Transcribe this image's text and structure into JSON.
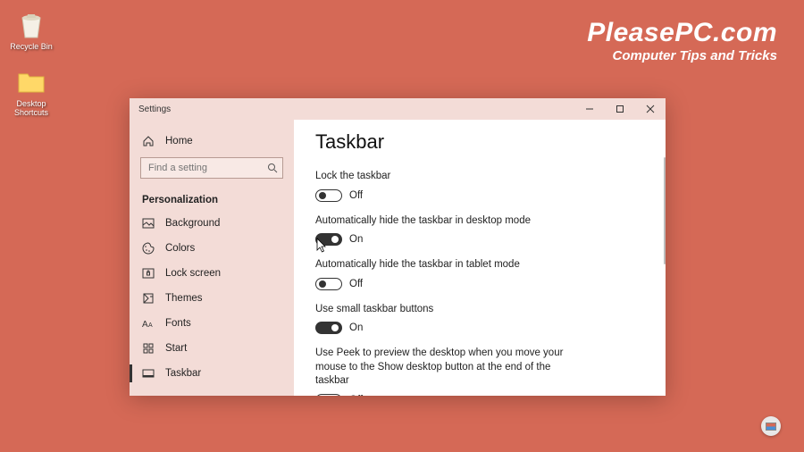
{
  "desktop": {
    "icons": [
      {
        "label": "Recycle Bin"
      },
      {
        "label": "Desktop Shortcuts"
      }
    ]
  },
  "brand": {
    "title": "PleasePC.com",
    "subtitle": "Computer Tips and Tricks"
  },
  "window": {
    "title": "Settings",
    "home_label": "Home",
    "search_placeholder": "Find a setting",
    "section_label": "Personalization",
    "nav": [
      {
        "label": "Background"
      },
      {
        "label": "Colors"
      },
      {
        "label": "Lock screen"
      },
      {
        "label": "Themes"
      },
      {
        "label": "Fonts"
      },
      {
        "label": "Start"
      },
      {
        "label": "Taskbar"
      }
    ]
  },
  "page": {
    "heading": "Taskbar",
    "settings": [
      {
        "label": "Lock the taskbar",
        "on": false,
        "state": "Off"
      },
      {
        "label": "Automatically hide the taskbar in desktop mode",
        "on": true,
        "state": "On"
      },
      {
        "label": "Automatically hide the taskbar in tablet mode",
        "on": false,
        "state": "Off"
      },
      {
        "label": "Use small taskbar buttons",
        "on": true,
        "state": "On"
      },
      {
        "label": "Use Peek to preview the desktop when you move your mouse to the Show desktop button at the end of the taskbar",
        "on": false,
        "state": "Off"
      }
    ]
  }
}
